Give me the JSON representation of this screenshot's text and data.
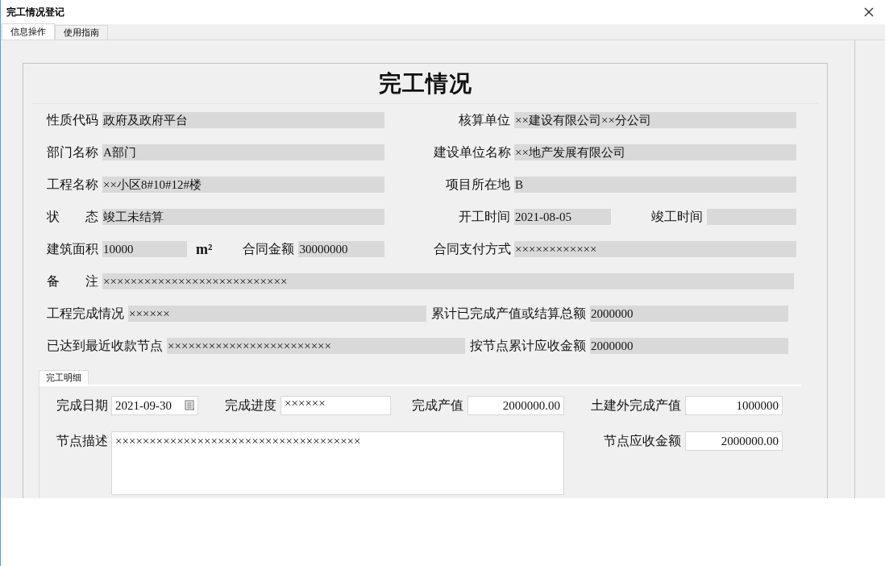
{
  "window": {
    "title": "完工情况登记"
  },
  "tabs": [
    {
      "label": "信息操作",
      "selected": true
    },
    {
      "label": "使用指南",
      "selected": false
    }
  ],
  "form": {
    "title": "完工情况",
    "rows": [
      {
        "kind": "pair",
        "fields": [
          {
            "label": "性质代码",
            "value": "政府及政府平台"
          },
          {
            "label": "核算单位",
            "value": "××建设有限公司××分公司"
          }
        ]
      },
      {
        "kind": "pair",
        "fields": [
          {
            "label": "部门名称",
            "value": "A部门"
          },
          {
            "label": "建设单位名称",
            "value": "××地产发展有限公司"
          }
        ]
      },
      {
        "kind": "pair",
        "fields": [
          {
            "label": "工程名称",
            "value": "××小区8#10#12#楼"
          },
          {
            "label": "项目所在地",
            "value": "B"
          }
        ]
      },
      {
        "kind": "status_dates",
        "fields": [
          {
            "label": "状　　态",
            "value": "竣工未结算"
          },
          {
            "label": "开工时间",
            "value": "2021-08-05"
          },
          {
            "label": "竣工时间"
          }
        ]
      },
      {
        "kind": "area",
        "unit": "m²",
        "fields": [
          {
            "label": "建筑面积",
            "value": "10000"
          },
          {
            "label": "合同金额",
            "value": "30000000"
          },
          {
            "label": "合同支付方式",
            "value": "××××××××××××"
          }
        ]
      },
      {
        "kind": "wide",
        "fields": [
          {
            "label": "备　　注",
            "value": "×××××××××××××××××××××××××××"
          }
        ]
      },
      {
        "kind": "pair_wide",
        "fields": [
          {
            "label": "工程完成情况",
            "value": "××××××"
          },
          {
            "label": "累计已完成产值或结算总额",
            "value": "2000000"
          }
        ]
      },
      {
        "kind": "pair_wide",
        "fields": [
          {
            "label": "已达到最近收款节点",
            "value": "××××××××××××××××××××××××"
          },
          {
            "label": "按节点累计应收金额",
            "value": "2000000"
          }
        ]
      }
    ]
  },
  "detail": {
    "tab": {
      "label": "完工明细",
      "selected": true
    },
    "fields": [
      {
        "kind": "date",
        "label": "完成日期",
        "value": "2021-09-30"
      },
      {
        "kind": "text",
        "label": "完成进度",
        "value": "××××××"
      },
      {
        "kind": "number",
        "label": "完成产值",
        "value": "2000000.00"
      },
      {
        "kind": "number",
        "label": "土建外完成产值",
        "value": "1000000"
      },
      {
        "kind": "textarea",
        "label": "节点描述",
        "value": "××××××××××××××××××××××××××××××××××××"
      },
      {
        "kind": "number",
        "label": "节点应收金额",
        "value": "2000000.00"
      }
    ]
  }
}
